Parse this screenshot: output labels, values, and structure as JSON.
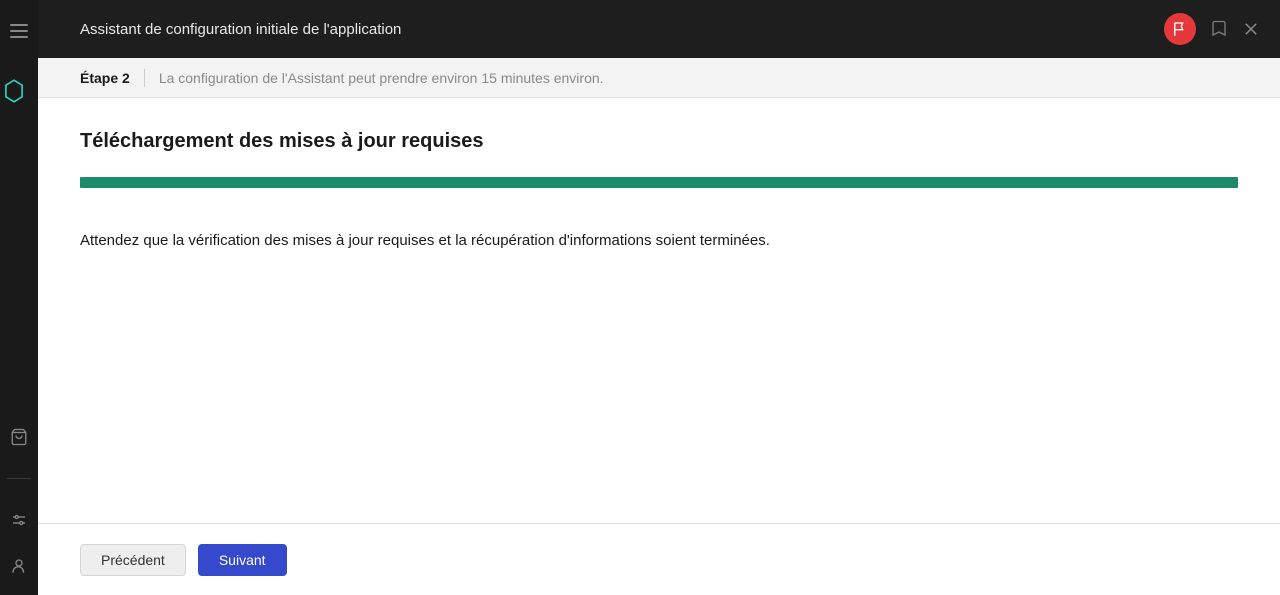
{
  "header": {
    "title": "Assistant de configuration initiale de l'application"
  },
  "step_bar": {
    "step_label": "Étape 2",
    "description": "La configuration de l'Assistant peut prendre environ 15 minutes environ."
  },
  "content": {
    "title": "Téléchargement des mises à jour requises",
    "progress_percent": 100,
    "body_text": "Attendez que la vérification des mises à jour requises et la récupération d'informations soient terminées."
  },
  "footer": {
    "back_label": "Précédent",
    "next_label": "Suivant"
  },
  "icons": {
    "menu": "menu-icon",
    "flag": "flag-icon",
    "bookmark": "bookmark-icon",
    "close": "close-icon",
    "bag": "bag-icon",
    "sliders": "sliders-icon",
    "user": "user-icon"
  },
  "colors": {
    "accent": "#3549cc",
    "progress": "#1d8a6b",
    "alert": "#e5383b"
  }
}
